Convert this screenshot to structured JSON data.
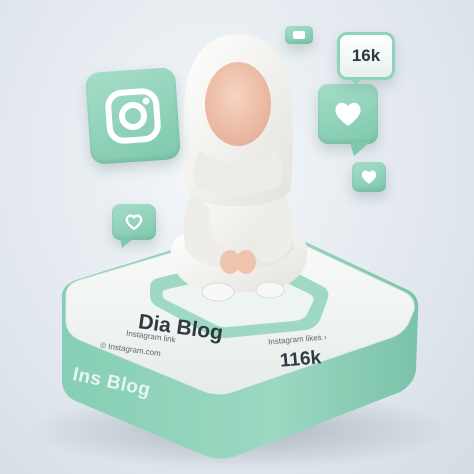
{
  "badge": {
    "count": "16k"
  },
  "platform": {
    "title": "Dia Blog",
    "subtitle": "Instagram link",
    "handle": "© Instagram.com",
    "stat_label": "Instagram likes ›",
    "stat_value": "116k",
    "side_label": "Ins Blog"
  },
  "colors": {
    "mint": "#8fd3bb",
    "mint_dark": "#6fbfa3",
    "platform_top": "#f3f6f4",
    "figure_white": "#f4f3ef",
    "face": "#f0c7b2"
  },
  "icons": [
    "instagram-icon",
    "heart-icon",
    "chat-bubble-icon"
  ]
}
